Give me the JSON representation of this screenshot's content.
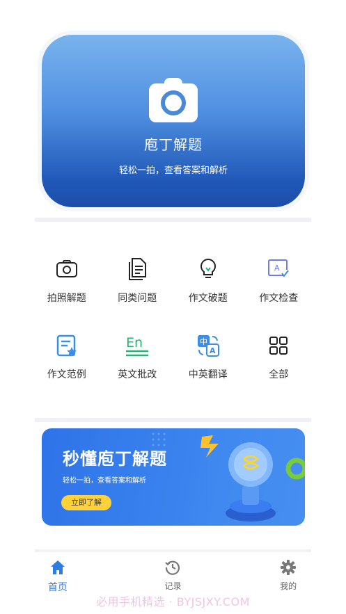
{
  "hero": {
    "title": "庖丁解题",
    "subtitle": "轻松一拍，查看答案和解析"
  },
  "tools": [
    {
      "label": "拍照解题",
      "icon": "camera-icon"
    },
    {
      "label": "同类问题",
      "icon": "documents-icon"
    },
    {
      "label": "作文破题",
      "icon": "lightbulb-icon"
    },
    {
      "label": "作文检查",
      "icon": "text-check-icon"
    },
    {
      "label": "作文范例",
      "icon": "document-star-icon"
    },
    {
      "label": "英文批改",
      "icon": "english-en-icon"
    },
    {
      "label": "中英翻译",
      "icon": "translate-icon"
    },
    {
      "label": "全部",
      "icon": "grid-icon"
    }
  ],
  "banner": {
    "title": "秒懂庖丁解题",
    "subtitle": "轻松一拍，查看答案和解析",
    "button": "立即了解"
  },
  "tabbar": [
    {
      "label": "首页",
      "icon": "home-icon",
      "active": true
    },
    {
      "label": "记录",
      "icon": "history-icon",
      "active": false
    },
    {
      "label": "我的",
      "icon": "settings-icon",
      "active": false
    }
  ],
  "watermark": "必用手机精选 · BYJSJXY.COM",
  "colors": {
    "accent": "#2f7de1",
    "hero_top": "#79b3ee",
    "hero_bottom": "#1b4ea8",
    "button_yellow": "#ffd23c",
    "green_icon": "#22b573"
  }
}
